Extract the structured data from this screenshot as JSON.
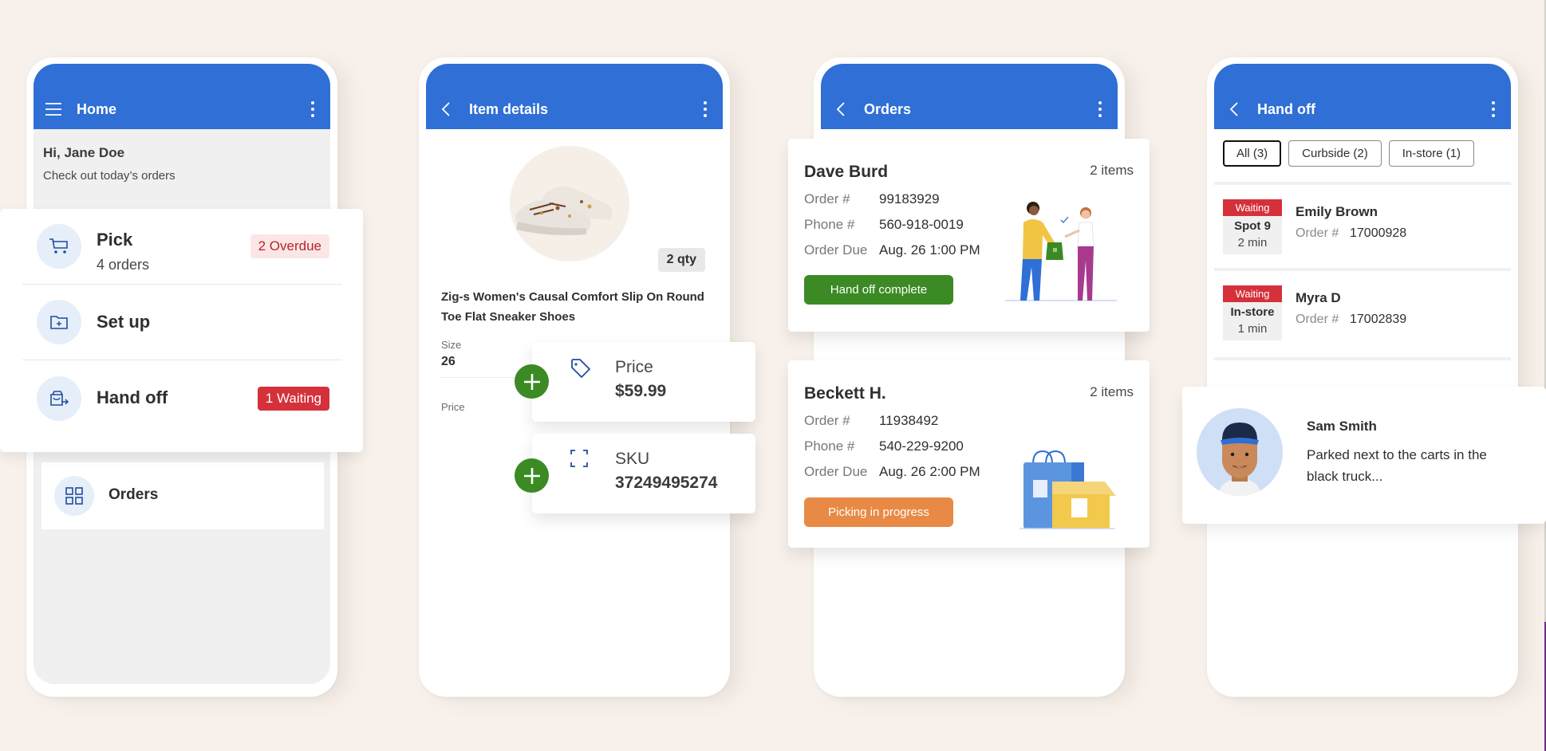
{
  "colors": {
    "background": "#f8f1eb",
    "appbar": "#2f6fd6",
    "overdue_bg": "#fbe6e6",
    "overdue_text": "#b4262d",
    "waiting": "#d4313b",
    "success": "#3b8a24",
    "in_progress": "#e88a45"
  },
  "home": {
    "appbar": {
      "title": "Home",
      "lead_icon": "menu-icon",
      "trail_icon": "more-vert-icon"
    },
    "greeting": "Hi, Jane Doe",
    "subtitle": "Check out today’s orders",
    "menu": [
      {
        "label": "Pick",
        "sublabel": "4 orders",
        "icon": "cart-icon",
        "badge": "2 Overdue"
      },
      {
        "label": "Set up",
        "icon": "folder-add-icon"
      },
      {
        "label": "Hand off",
        "icon": "handoff-bag-icon",
        "badge": "1 Waiting"
      }
    ],
    "orders_tile": {
      "label": "Orders",
      "icon": "grid-icon"
    }
  },
  "item_details": {
    "appbar": {
      "title": "Item details",
      "lead_icon": "back-icon",
      "trail_icon": "more-vert-icon"
    },
    "qty": "2 qty",
    "product_name": "Zig-s Women's Causal Comfort Slip On Round Toe Flat Sneaker Shoes",
    "size_label": "Size",
    "size_value": "26",
    "price_label": "Price",
    "cards": [
      {
        "label": "Price",
        "value": "$59.99",
        "icon": "price-tag-icon"
      },
      {
        "label": "SKU",
        "value": "37249495274",
        "icon": "scan-icon"
      }
    ]
  },
  "orders": {
    "appbar": {
      "title": "Orders",
      "lead_icon": "back-icon",
      "trail_icon": "more-vert-icon"
    },
    "field_labels": {
      "order": "Order #",
      "phone": "Phone #",
      "due": "Order Due"
    },
    "cards": [
      {
        "name": "Dave Burd",
        "items": "2 items",
        "order": "99183929",
        "phone": "560-918-0019",
        "due": "Aug. 26  1:00 PM",
        "status": "Hand off complete"
      },
      {
        "name": "Beckett H.",
        "items": "2 items",
        "order": "11938492",
        "phone": "540-229-9200",
        "due": "Aug. 26  2:00 PM",
        "status": "Picking in progress"
      }
    ]
  },
  "handoff": {
    "appbar": {
      "title": "Hand off",
      "lead_icon": "back-icon",
      "trail_icon": "more-vert-icon"
    },
    "filters": [
      "All (3)",
      "Curbside (2)",
      "In-store (1)"
    ],
    "order_label": "Order #",
    "rows": [
      {
        "status": "Waiting",
        "location": "Spot 9",
        "time": "2 min",
        "name": "Emily Brown",
        "order": "17000928"
      },
      {
        "status": "Waiting",
        "location": "In-store",
        "time": "1 min",
        "name": "Myra D",
        "order": "17002839"
      }
    ],
    "message": {
      "name": "Sam Smith",
      "text": "Parked next to the carts in the black truck..."
    }
  }
}
